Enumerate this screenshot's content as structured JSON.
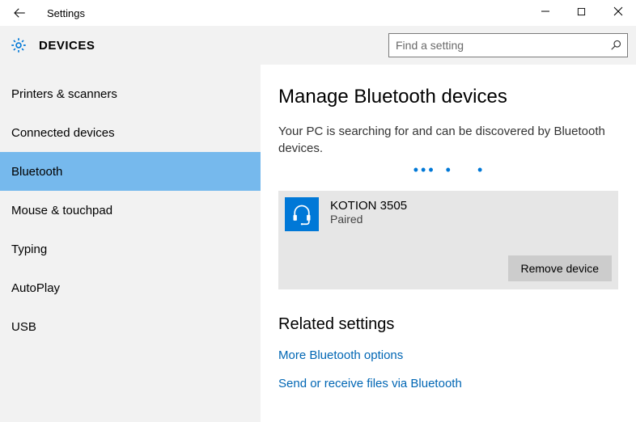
{
  "title": "Settings",
  "pageHeader": "DEVICES",
  "search": {
    "placeholder": "Find a setting"
  },
  "sidebar": {
    "items": [
      {
        "label": "Printers & scanners"
      },
      {
        "label": "Connected devices"
      },
      {
        "label": "Bluetooth",
        "selected": true
      },
      {
        "label": "Mouse & touchpad"
      },
      {
        "label": "Typing"
      },
      {
        "label": "AutoPlay"
      },
      {
        "label": "USB"
      }
    ]
  },
  "main": {
    "heading": "Manage Bluetooth devices",
    "statusText": "Your PC is searching for and can be discovered by Bluetooth devices.",
    "device": {
      "name": "KOTION 3505",
      "status": "Paired",
      "removeLabel": "Remove device"
    },
    "related": {
      "heading": "Related settings",
      "links": [
        "More Bluetooth options",
        "Send or receive files via Bluetooth"
      ]
    }
  }
}
